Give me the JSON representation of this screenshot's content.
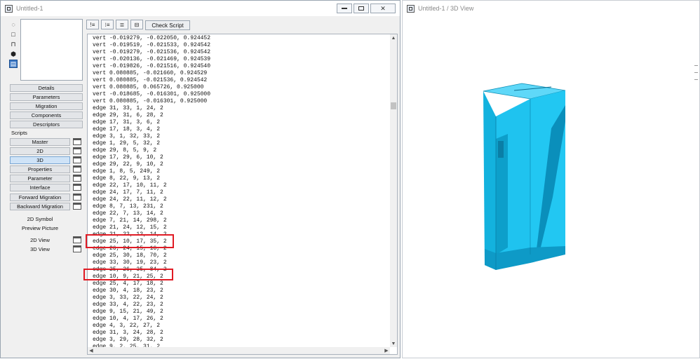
{
  "editor_window": {
    "title": "Untitled-1",
    "toolbar": {
      "check_script_label": "Check Script"
    },
    "panel_buttons": [
      "Details",
      "Parameters",
      "Migration",
      "Components",
      "Descriptors"
    ],
    "scripts_label": "Scripts",
    "script_buttons": [
      {
        "label": "Master",
        "active": false
      },
      {
        "label": "2D",
        "active": false
      },
      {
        "label": "3D",
        "active": true
      },
      {
        "label": "Properties",
        "active": false
      },
      {
        "label": "Parameter",
        "active": false
      },
      {
        "label": "Interface",
        "active": false
      },
      {
        "label": "Forward Migration",
        "active": false
      },
      {
        "label": "Backward Migration",
        "active": false
      }
    ],
    "other_buttons": [
      "2D Symbol",
      "Preview Picture"
    ],
    "view_buttons": [
      "2D View",
      "3D View"
    ],
    "code_lines": [
      "vert -0.019279, -0.022050, 0.924452",
      "vert -0.019519, -0.021533, 0.924542",
      "vert -0.019279, -0.021536, 0.924542",
      "vert -0.020136, -0.021469, 0.924539",
      "vert -0.019826, -0.021516, 0.924540",
      "vert 0.080885, -0.021660, 0.924529",
      "vert 0.080885, -0.021536, 0.924542",
      "vert 0.080885, 0.065726, 0.925000",
      "vert -0.018685, -0.016301, 0.925000",
      "vert 0.080885, -0.016301, 0.925000",
      "edge 31, 33, 1, 24, 2",
      "edge 29, 31, 6, 28, 2",
      "edge 17, 31, 3, 6, 2",
      "edge 17, 18, 3, 4, 2",
      "edge 3, 1, 32, 33, 2",
      "edge 1, 29, 5, 32, 2",
      "edge 29, 8, 5, 9, 2",
      "edge 17, 29, 6, 10, 2",
      "edge 29, 22, 9, 10, 2",
      "edge 1, 8, 5, 249, 2",
      "edge 8, 22, 9, 13, 2",
      "edge 22, 17, 10, 11, 2",
      "edge 24, 17, 7, 11, 2",
      "edge 24, 22, 11, 12, 2",
      "edge 8, 7, 13, 231, 2",
      "edge 22, 7, 13, 14, 2",
      "edge 7, 21, 14, 298, 2",
      "edge 21, 24, 12, 15, 2",
      "edge 21, 22, 12, 14, 2",
      "edge 25, 10, 17, 35, 2",
      "edge 26, 24, 15, 16, 2",
      "edge 25, 30, 18, 70, 2",
      "edge 33, 30, 19, 23, 2",
      "edge 25, 26, 35, 84, 2",
      "edge 10, 9, 21, 25, 2",
      "edge 25, 4, 17, 18, 2",
      "edge 30, 4, 18, 23, 2",
      "edge 3, 33, 22, 24, 2",
      "edge 33, 4, 22, 23, 2",
      "edge 9, 15, 21, 49, 2",
      "edge 10, 4, 17, 26, 2",
      "edge 4, 3, 22, 27, 2",
      "edge 31, 3, 24, 28, 2",
      "edge 3, 29, 28, 32, 2",
      "edge 9, 2, 25, 31, 2"
    ]
  },
  "view_window": {
    "title": "Untitled-1 / 3D View"
  },
  "colors": {
    "highlight": "#e01b24",
    "model_front": "#1fc3ef",
    "model_side": "#12a9d6",
    "model_top": "#5fd8f8",
    "active_button": "#cfe3f7"
  }
}
